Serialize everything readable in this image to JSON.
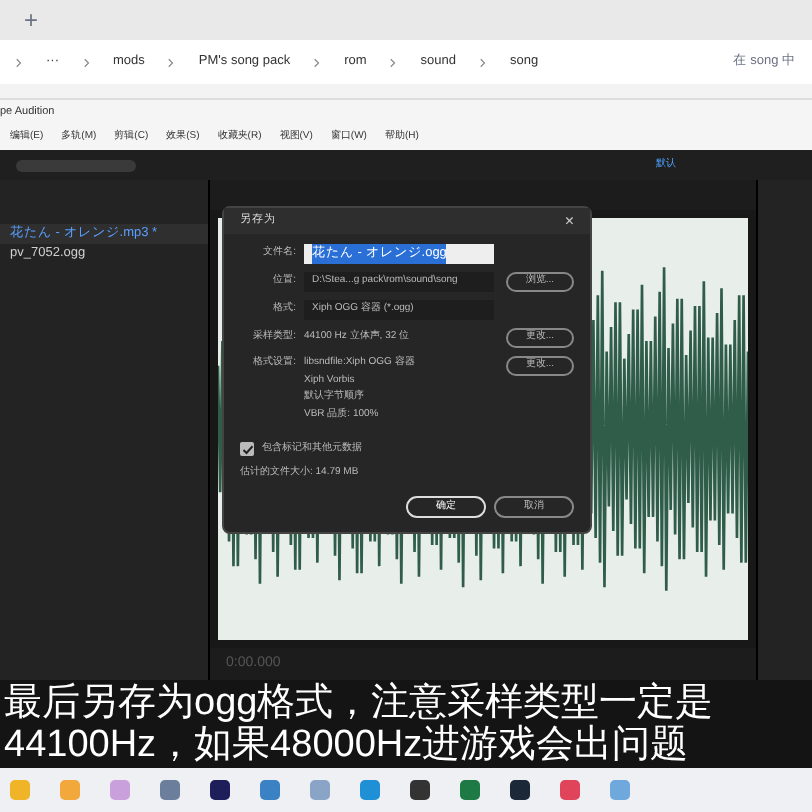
{
  "explorer": {
    "new_tab": "+",
    "path": [
      "···",
      "mods",
      "PM's song pack",
      "rom",
      "sound",
      "song"
    ],
    "search": {
      "placeholder": "在 song 中"
    }
  },
  "audition": {
    "title": "pe Audition",
    "menu": [
      "编辑(E)",
      "多轨(M)",
      "剪辑(C)",
      "效果(S)",
      "收藏夹(R)",
      "视图(V)",
      "窗口(W)",
      "帮助(H)"
    ],
    "workspace": "默认",
    "files": [
      {
        "name": "花たん - オレンジ.mp3 *",
        "selected": true
      },
      {
        "name": "pv_7052.ogg",
        "selected": false
      }
    ],
    "time": "0:00.000"
  },
  "dialog": {
    "title": "另存为",
    "close": "×",
    "filename": {
      "label": "文件名:",
      "value": "花たん - オレンジ.ogg"
    },
    "location": {
      "label": "位置:",
      "value": "D:\\Stea...g pack\\rom\\sound\\song"
    },
    "browse": "浏览...",
    "format": {
      "label": "格式:",
      "value": "Xiph OGG 容器 (*.ogg)"
    },
    "sample": {
      "label": "采样类型:",
      "value": "44100 Hz 立体声, 32 位",
      "button": "更改..."
    },
    "settings": {
      "label": "格式设置:",
      "lines": [
        "libsndfile:Xiph OGG 容器",
        "Xiph Vorbis",
        "默认字节顺序",
        "VBR 品质: 100%"
      ],
      "button": "更改..."
    },
    "metadata": {
      "label": "包含标记和其他元数据",
      "checked": true
    },
    "size": "估计的文件大小: 14.79 MB",
    "buttons": [
      "确定",
      "取消"
    ]
  },
  "subtitle": [
    "最后另存为ogg格式，注意采样类型一定是",
    "44100Hz，如果48000Hz进游戏会出问题"
  ]
}
